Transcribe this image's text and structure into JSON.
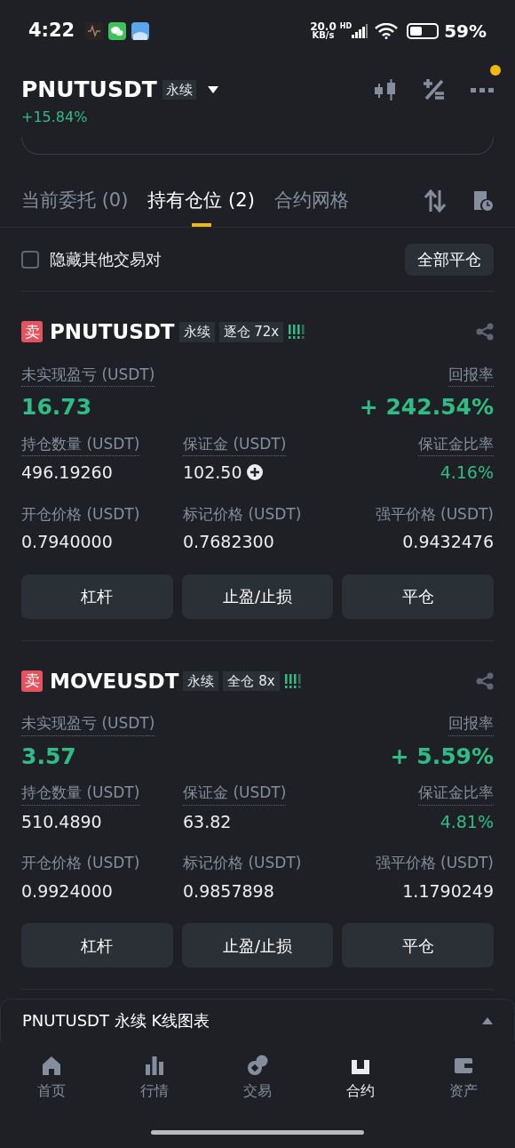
{
  "status_bar": {
    "time": "4:22",
    "speed": "20.0",
    "speed_unit": "KB/s",
    "network": "HD",
    "battery": "59%"
  },
  "header": {
    "symbol": "PNUTUSDT",
    "badge": "永续",
    "change": "+15.84%",
    "notification_dot": true
  },
  "tabs": [
    {
      "label": "当前委托 (0)",
      "selected": false
    },
    {
      "label": "持有仓位 (2)",
      "selected": true
    },
    {
      "label": "合约网格",
      "selected": false
    }
  ],
  "hide_pairs": {
    "label": "隐藏其他交易对",
    "checked": false
  },
  "close_all_button": "全部平仓",
  "positions": [
    {
      "side": "卖",
      "symbol": "PNUTUSDT",
      "tags": [
        "永续",
        "逐仓 72x"
      ],
      "pnl_label": "未实现盈亏 (USDT)",
      "pnl": "16.73",
      "roe_label": "回报率",
      "roe": "+ 242.54%",
      "stats": [
        {
          "label": "持仓数量 (USDT)",
          "value": "496.19260"
        },
        {
          "label": "保证金 (USDT)",
          "value": "102.50",
          "add_margin": true
        },
        {
          "label": "保证金比率",
          "value": "4.16%",
          "kind": "ratio"
        },
        {
          "label": "开仓价格 (USDT)",
          "value": "0.7940000"
        },
        {
          "label": "标记价格 (USDT)",
          "value": "0.7682300"
        },
        {
          "label": "强平价格 (USDT)",
          "value": "0.9432476"
        }
      ],
      "buttons": [
        "杠杆",
        "止盈/止损",
        "平仓"
      ]
    },
    {
      "side": "卖",
      "symbol": "MOVEUSDT",
      "tags": [
        "永续",
        "全仓 8x"
      ],
      "pnl_label": "未实现盈亏 (USDT)",
      "pnl": "3.57",
      "roe_label": "回报率",
      "roe": "+ 5.59%",
      "stats": [
        {
          "label": "持仓数量 (USDT)",
          "value": "510.4890"
        },
        {
          "label": "保证金 (USDT)",
          "value": "63.82",
          "add_margin": false
        },
        {
          "label": "保证金比率",
          "value": "4.81%",
          "kind": "ratio"
        },
        {
          "label": "开仓价格 (USDT)",
          "value": "0.9924000"
        },
        {
          "label": "标记价格 (USDT)",
          "value": "0.9857898"
        },
        {
          "label": "强平价格 (USDT)",
          "value": "1.1790249"
        }
      ],
      "buttons": [
        "杠杆",
        "止盈/止损",
        "平仓"
      ]
    }
  ],
  "chart_bar": {
    "title": "PNUTUSDT 永续 K线图表",
    "expanded": false
  },
  "bottom_nav": [
    {
      "label": "首页",
      "kind": "home",
      "selected": false
    },
    {
      "label": "行情",
      "kind": "markets",
      "selected": false
    },
    {
      "label": "交易",
      "kind": "trade",
      "selected": false
    },
    {
      "label": "合约",
      "kind": "futures",
      "selected": true
    },
    {
      "label": "资产",
      "kind": "wallet",
      "selected": false
    }
  ]
}
